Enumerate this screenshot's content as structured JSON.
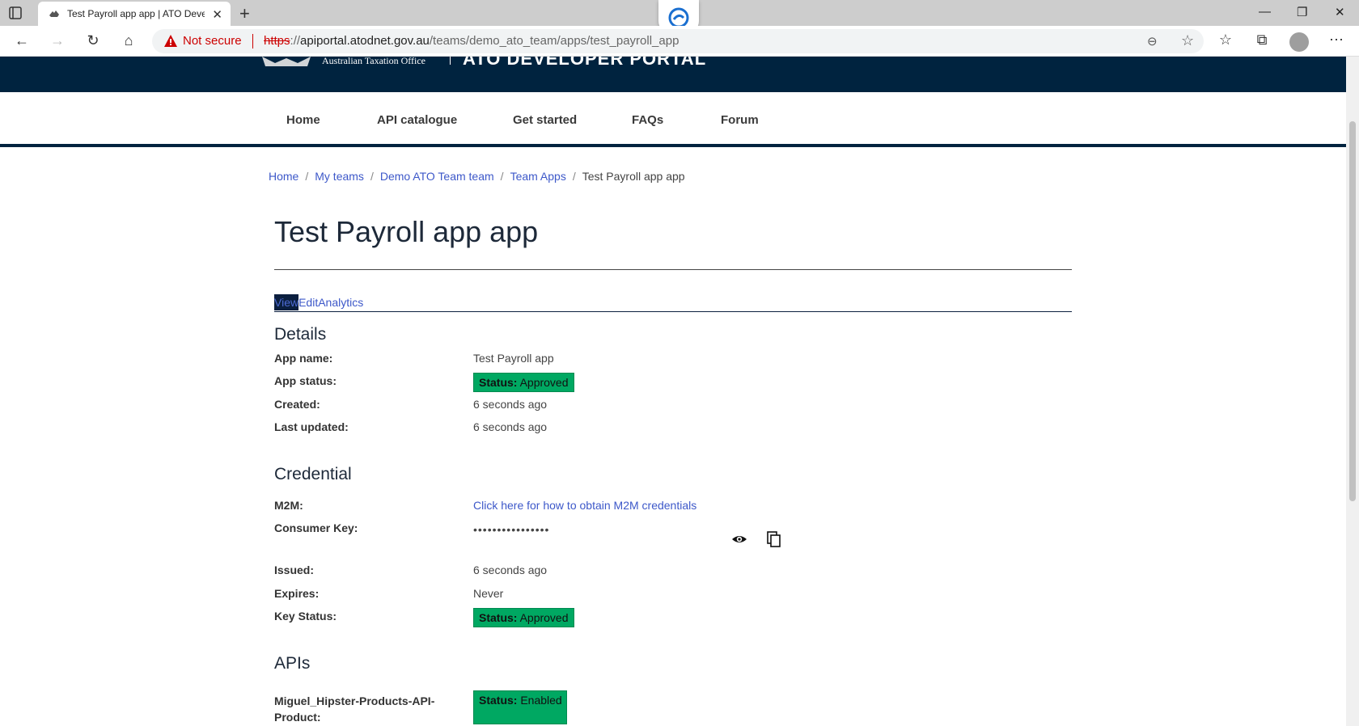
{
  "browser": {
    "tab_title": "Test Payroll app app | ATO Devel",
    "security_label": "Not secure",
    "url_scheme": "https",
    "url_sep": "://",
    "url_host": "apiportal.atodnet.gov.au",
    "url_path": "/teams/demo_ato_team/apps/test_payroll_app"
  },
  "header": {
    "org_name": "Australian Taxation Office",
    "site_name": "ATO DEVELOPER PORTAL"
  },
  "nav": {
    "items": [
      "Home",
      "API catalogue",
      "Get started",
      "FAQs",
      "Forum"
    ]
  },
  "breadcrumb": {
    "items": [
      "Home",
      "My teams",
      "Demo ATO Team team",
      "Team Apps"
    ],
    "current": "Test Payroll app app"
  },
  "page": {
    "title": "Test Payroll app app",
    "tabs": [
      "View",
      "Edit",
      "Analytics"
    ]
  },
  "details": {
    "heading": "Details",
    "app_name_label": "App name:",
    "app_name": "Test Payroll app",
    "app_status_label": "App status:",
    "status_prefix": "Status:",
    "app_status": "Approved",
    "created_label": "Created:",
    "created": "6 seconds ago",
    "updated_label": "Last updated:",
    "updated": "6 seconds ago"
  },
  "credential": {
    "heading": "Credential",
    "m2m_label": "M2M:",
    "m2m_link": "Click here for how to obtain M2M credentials",
    "key_label": "Consumer Key:",
    "key_masked": "••••••••••••••••",
    "issued_label": "Issued:",
    "issued": "6 seconds ago",
    "expires_label": "Expires:",
    "expires": "Never",
    "key_status_label": "Key Status:",
    "key_status": "Approved"
  },
  "apis": {
    "heading": "APIs",
    "product_label_1": "Miguel_Hipster-Products-API-",
    "product_label_2": "Product:",
    "product_status": "Enabled"
  },
  "colors": {
    "navy": "#00233f",
    "link": "#3d58c9",
    "status_green": "#00a862"
  }
}
